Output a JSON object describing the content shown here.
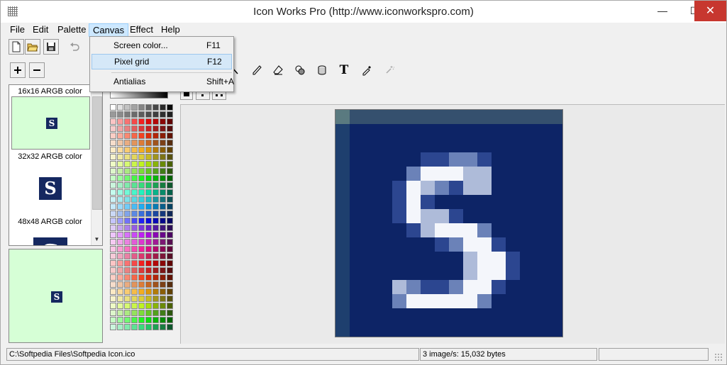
{
  "window": {
    "title": "Icon Works Pro (http://www.iconworkspro.com)",
    "min_glyph": "—",
    "max_glyph": "☐",
    "close_glyph": "✕"
  },
  "menubar": {
    "items": [
      "File",
      "Edit",
      "Palette",
      "Canvas",
      "Effect",
      "Help"
    ],
    "active": "Canvas"
  },
  "canvas_menu": {
    "items": [
      {
        "label": "Screen color...",
        "shortcut": "F11"
      },
      {
        "label": "Pixel grid",
        "shortcut": "F12"
      },
      {
        "label": "Antialias",
        "shortcut": "Shift+A"
      }
    ],
    "highlighted": "Pixel grid"
  },
  "toolbar": {
    "icons": [
      "new-icon",
      "open-icon",
      "save-icon",
      "undo-icon",
      "zoom-in-icon",
      "zoom-out-icon",
      "line-icon",
      "pencil-icon",
      "eraser-icon",
      "fill-icon",
      "bucket-icon",
      "text-icon",
      "eyedropper-icon",
      "magic-wand-icon"
    ],
    "text_tool_glyph": "T"
  },
  "image_list": {
    "entries": [
      {
        "label": "16x16 ARGB color",
        "glyph": "S"
      },
      {
        "label": "32x32 ARGB color",
        "glyph": "S"
      },
      {
        "label": "48x48 ARGB color",
        "glyph": "S"
      }
    ],
    "scroll_down_glyph": "▼",
    "scroll_up_glyph": "▲"
  },
  "preview": {
    "glyph": "S"
  },
  "statusbar": {
    "path": "C:\\Softpedia Files\\Softpedia Icon.ico",
    "info": "3 image/s:  15,032 bytes"
  },
  "colors": {
    "selection": "#cde8ff",
    "preview_bg": "#d6ffd6",
    "icon_bg": "#152860",
    "close_button": "#c7372f"
  }
}
